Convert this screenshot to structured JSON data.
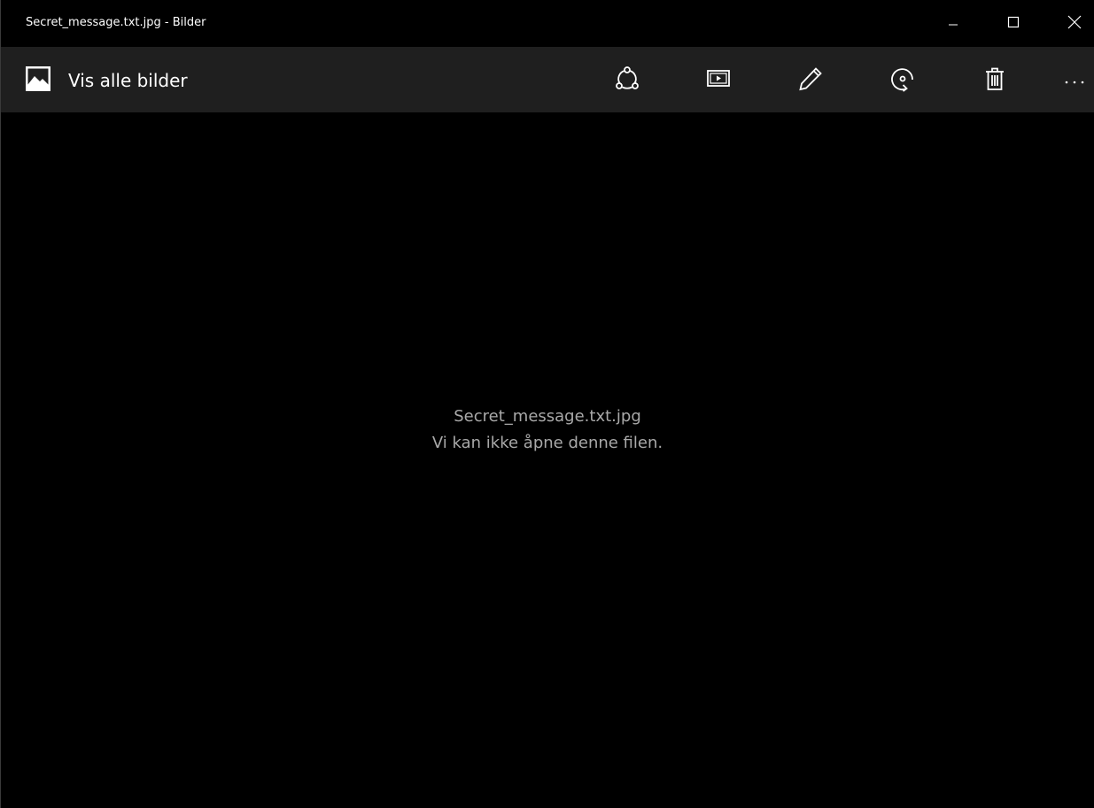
{
  "window": {
    "title": "Secret_message.txt.jpg - Bilder",
    "controls": {
      "minimize": "minimize-icon",
      "maximize": "maximize-icon",
      "close": "close-icon"
    }
  },
  "toolbar": {
    "back_label": "Vis alle bilder",
    "back_icon": "picture-icon",
    "buttons": [
      {
        "name": "share",
        "icon": "share-icon"
      },
      {
        "name": "slideshow",
        "icon": "slideshow-icon"
      },
      {
        "name": "edit",
        "icon": "pencil-icon"
      },
      {
        "name": "rotate",
        "icon": "rotate-icon"
      },
      {
        "name": "delete",
        "icon": "trash-icon"
      },
      {
        "name": "more",
        "icon": "more-icon"
      }
    ]
  },
  "content": {
    "filename": "Secret_message.txt.jpg",
    "error": "Vi kan ikke åpne denne filen."
  },
  "colors": {
    "titlebar_bg": "#000000",
    "toolbar_bg": "#1f1f1f",
    "content_bg": "#000000",
    "text_primary": "#ffffff",
    "text_secondary": "#a9a9a9"
  }
}
